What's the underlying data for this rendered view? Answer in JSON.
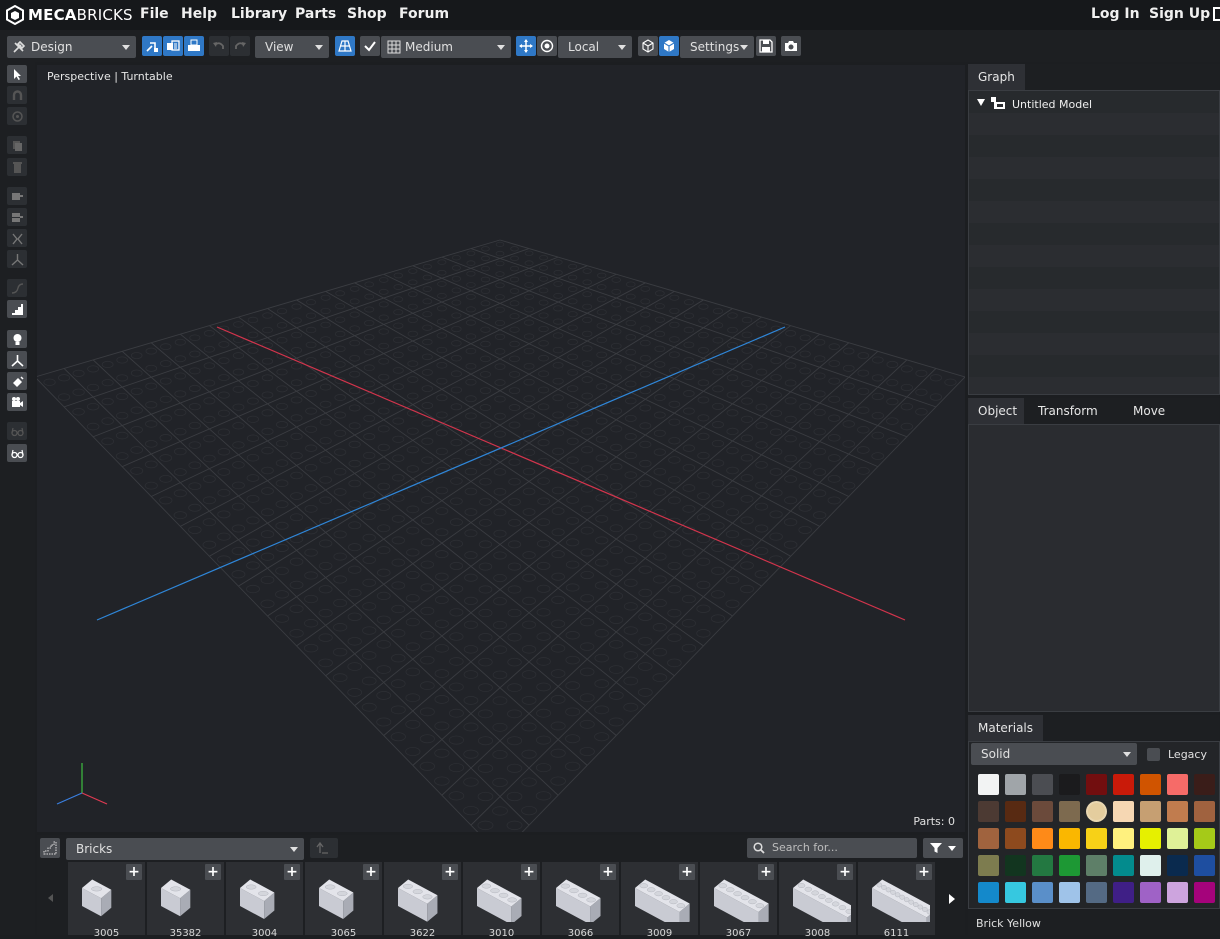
{
  "brand": {
    "name_bold": "MECA",
    "name_light": "BRICKS"
  },
  "menu": {
    "file": "File",
    "help": "Help",
    "library": "Library",
    "parts": "Parts",
    "shop": "Shop",
    "forum": "Forum",
    "login": "Log In",
    "signup": "Sign Up"
  },
  "toolbar": {
    "mode": "Design",
    "view": "View",
    "quality": "Medium",
    "space": "Local",
    "settings": "Settings"
  },
  "viewport": {
    "label": "Perspective | Turntable",
    "parts_count": "Parts: 0"
  },
  "graph_panel": {
    "tab": "Graph",
    "root_item": "Untitled Model"
  },
  "props_panel": {
    "tabs": [
      "Object",
      "Transform",
      "Move"
    ]
  },
  "materials": {
    "tab": "Materials",
    "type": "Solid",
    "legacy_label": "Legacy",
    "selected_name": "Brick Yellow",
    "colors": [
      "#f2f3f3",
      "#a0a5a9",
      "#4b4d52",
      "#1b1b1d",
      "#720e0f",
      "#c91a09",
      "#d05400",
      "#f66b68",
      "#3a1d19",
      "#4c3a33",
      "#582a12",
      "#6b4a3b",
      "#7d6a4f",
      "#e4cd9e",
      "#f6d7b3",
      "#c69f72",
      "#c17c4e",
      "#a0623f",
      "#a0633e",
      "#8d4a1e",
      "#fe8a18",
      "#fab700",
      "#f7d117",
      "#fff17e",
      "#e6f000",
      "#dff197",
      "#a5ca18",
      "#7d7c4f",
      "#12351f",
      "#237841",
      "#1d9834",
      "#5e7f68",
      "#038b8d",
      "#dff0ec",
      "#0a2a4e",
      "#1e4ea0",
      "#1489cb",
      "#36c8e0",
      "#5a8fc9",
      "#9fc3e9",
      "#546a84",
      "#3f1f86",
      "#9f62c6",
      "#cda4de",
      "#a5037b"
    ]
  },
  "parts_bar": {
    "category": "Bricks",
    "search_placeholder": "Search for...",
    "items": [
      "3005",
      "35382",
      "3004",
      "3065",
      "3622",
      "3010",
      "3066",
      "3009",
      "3067",
      "3008",
      "6111"
    ]
  }
}
